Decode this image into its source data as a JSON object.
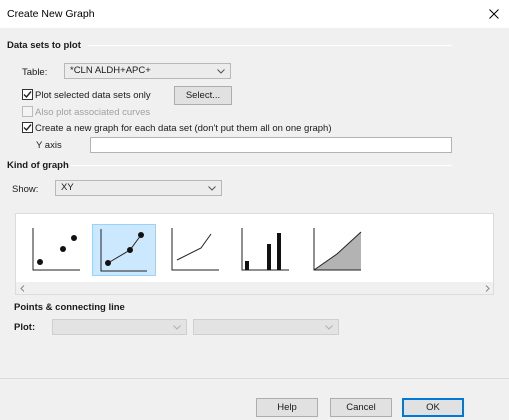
{
  "dialog": {
    "title": "Create New Graph"
  },
  "datasets": {
    "heading": "Data sets to plot",
    "table_label": "Table:",
    "table_value": "*CLN ALDH+APC+",
    "plot_selected_label": "Plot selected data sets only",
    "plot_selected_checked": true,
    "also_plot_label": "Also plot associated curves",
    "also_plot_checked": false,
    "select_button": "Select...",
    "new_graph_label": "Create a new graph for each data set (don't put them all on one graph)",
    "new_graph_checked": true,
    "yaxis_label": "Y axis",
    "yaxis_value": ""
  },
  "kind": {
    "heading": "Kind of graph",
    "show_label": "Show:",
    "show_value": "XY",
    "thumbnails": [
      {
        "name": "points-only",
        "selected": false
      },
      {
        "name": "points-and-line",
        "selected": true
      },
      {
        "name": "line-only",
        "selected": false
      },
      {
        "name": "spikes",
        "selected": false
      },
      {
        "name": "area-fill",
        "selected": false
      }
    ],
    "points_heading": "Points & connecting line",
    "plot_label": "Plot:",
    "plot_value_1": "",
    "plot_value_2": ""
  },
  "footer": {
    "help_button": "Help",
    "cancel_button": "Cancel",
    "ok_button": "OK"
  },
  "colors": {
    "accent": "#0078d7",
    "selection": "#cce8ff",
    "selection_border": "#99d1ff"
  }
}
